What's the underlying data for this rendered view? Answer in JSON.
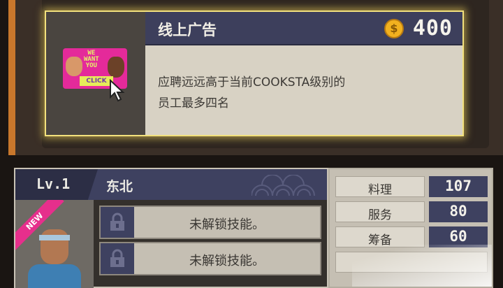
{
  "ad_card": {
    "title": "线上广告",
    "price": "400",
    "coin_symbol": "$",
    "description_line1": "应聘远远高于当前COOKSTA级别的",
    "description_line2": "员工最多四名",
    "thumbnail_text_we": "WE",
    "thumbnail_text_want": "WANT",
    "thumbnail_text_you": "YOU",
    "thumbnail_button": "CLICK"
  },
  "staff": {
    "level": "Lv.1",
    "origin": "东北",
    "badge": "NEW",
    "skills": [
      "未解锁技能。",
      "未解锁技能。"
    ]
  },
  "stats": [
    {
      "label": "料理",
      "value": "107"
    },
    {
      "label": "服务",
      "value": "80"
    },
    {
      "label": "筹备",
      "value": "60"
    }
  ],
  "colors": {
    "header_navy": "#3e4160",
    "card_glow": "#f2e17d",
    "coin_gold": "#f2b11f",
    "new_badge": "#e62f8c"
  }
}
